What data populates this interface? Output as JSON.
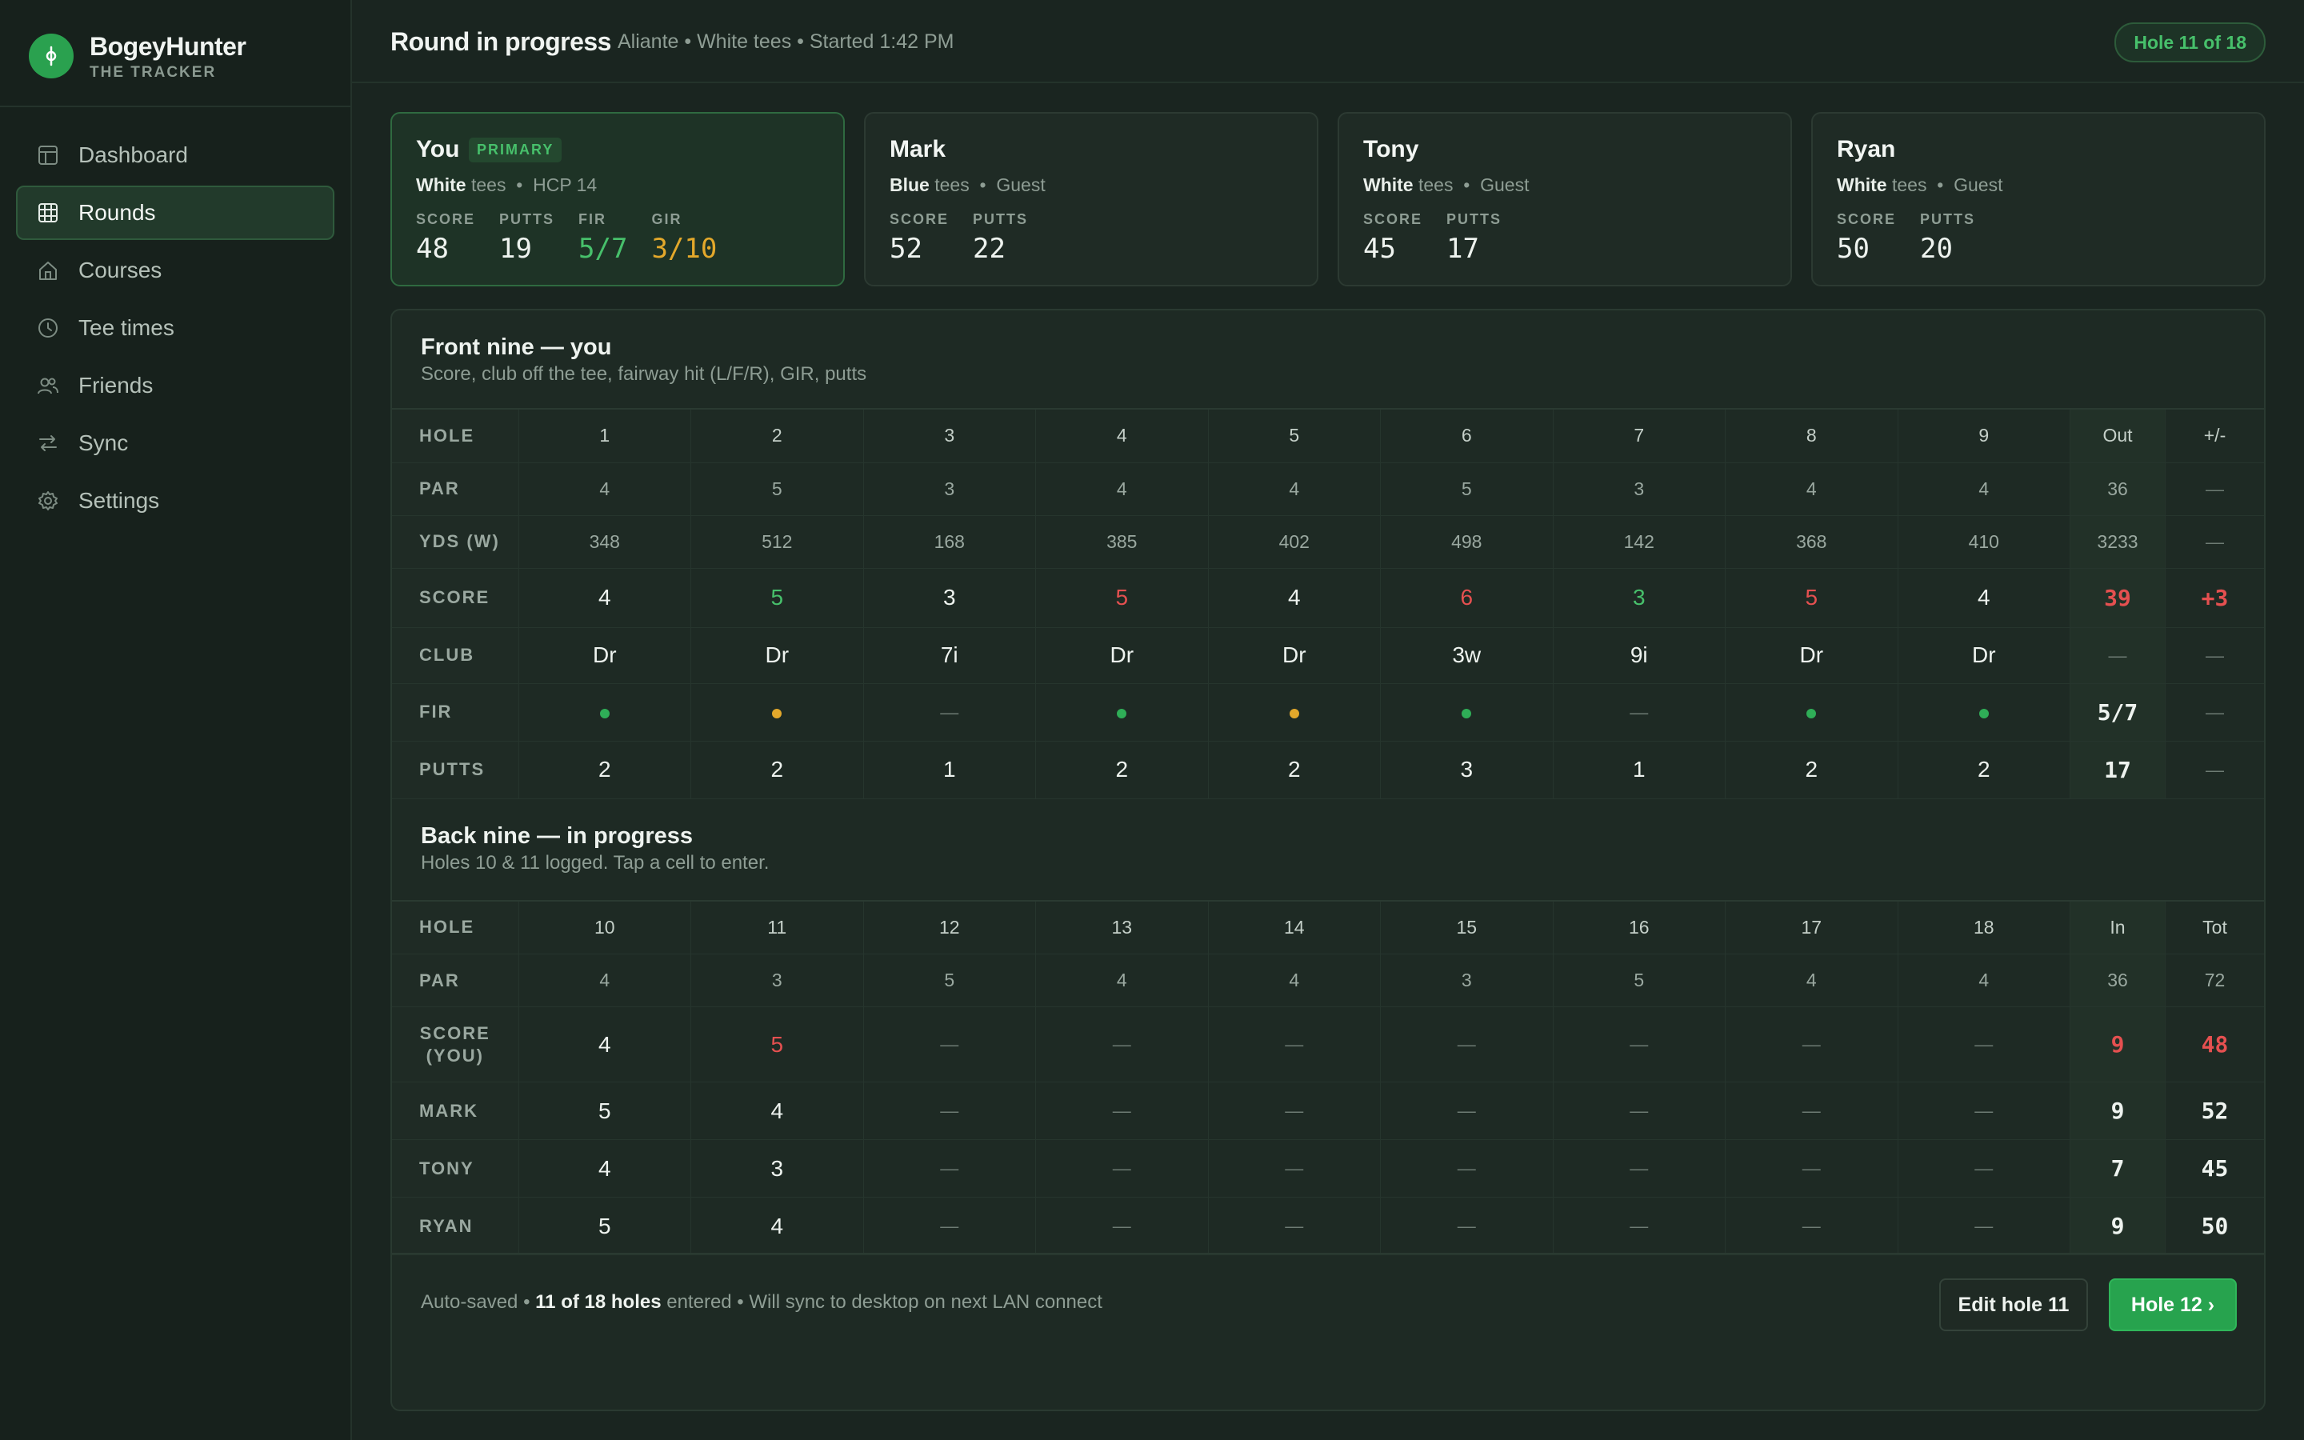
{
  "brand": {
    "name": "BogeyHunter",
    "subtitle": "THE TRACKER"
  },
  "nav": [
    {
      "label": "Dashboard",
      "icon": "dashboard-icon",
      "active": false
    },
    {
      "label": "Rounds",
      "icon": "scorecard-icon",
      "active": true
    },
    {
      "label": "Courses",
      "icon": "home-icon",
      "active": false
    },
    {
      "label": "Tee times",
      "icon": "clock-icon",
      "active": false
    },
    {
      "label": "Friends",
      "icon": "users-icon",
      "active": false
    },
    {
      "label": "Sync",
      "icon": "sync-icon",
      "active": false
    },
    {
      "label": "Settings",
      "icon": "gear-icon",
      "active": false
    }
  ],
  "header": {
    "title": "Round in progress",
    "meta": "Aliante • White tees • Started 1:42 PM",
    "badge": "Hole 11 of 18"
  },
  "players": [
    {
      "name": "You",
      "badge": "PRIMARY",
      "tee": "White",
      "tee_suffix": "tees",
      "info": "HCP 14",
      "stats": [
        {
          "label": "SCORE",
          "value": "48",
          "tone": ""
        },
        {
          "label": "PUTTS",
          "value": "19",
          "tone": ""
        },
        {
          "label": "FIR",
          "value": "5/7",
          "tone": "green"
        },
        {
          "label": "GIR",
          "value": "3/10",
          "tone": "amber"
        }
      ]
    },
    {
      "name": "Mark",
      "badge": "",
      "tee": "Blue",
      "tee_suffix": "tees",
      "info": "Guest",
      "stats": [
        {
          "label": "SCORE",
          "value": "52",
          "tone": ""
        },
        {
          "label": "PUTTS",
          "value": "22",
          "tone": ""
        }
      ]
    },
    {
      "name": "Tony",
      "badge": "",
      "tee": "White",
      "tee_suffix": "tees",
      "info": "Guest",
      "stats": [
        {
          "label": "SCORE",
          "value": "45",
          "tone": ""
        },
        {
          "label": "PUTTS",
          "value": "17",
          "tone": ""
        }
      ]
    },
    {
      "name": "Ryan",
      "badge": "",
      "tee": "White",
      "tee_suffix": "tees",
      "info": "Guest",
      "stats": [
        {
          "label": "SCORE",
          "value": "50",
          "tone": ""
        },
        {
          "label": "PUTTS",
          "value": "20",
          "tone": ""
        }
      ]
    }
  ],
  "front": {
    "title": "Front nine — you",
    "subtitle": "Score, club off the tee, fairway hit (L/F/R), GIR, putts",
    "hole_label": "HOLE",
    "holes": [
      "1",
      "2",
      "3",
      "4",
      "5",
      "6",
      "7",
      "8",
      "9"
    ],
    "out_label": "Out",
    "diff_label": "+/-",
    "rows": [
      {
        "label": "PAR",
        "kind": "small",
        "cells": [
          "4",
          "5",
          "3",
          "4",
          "4",
          "5",
          "3",
          "4",
          "4"
        ],
        "tot": "36",
        "diff": "—"
      },
      {
        "label": "YDS (W)",
        "kind": "small",
        "cells": [
          "348",
          "512",
          "168",
          "385",
          "402",
          "498",
          "142",
          "368",
          "410"
        ],
        "tot": "3233",
        "diff": "—"
      },
      {
        "label": "SCORE",
        "kind": "score",
        "cells": [
          "4",
          "5",
          "3",
          "5",
          "4",
          "6",
          "3",
          "5",
          "4"
        ],
        "tones": [
          "",
          "green",
          "",
          "red",
          "",
          "red",
          "green",
          "red",
          ""
        ],
        "tot": "39",
        "tot_tone": "red",
        "diff": "+3",
        "diff_tone": "red"
      },
      {
        "label": "CLUB",
        "kind": "big",
        "cells": [
          "Dr",
          "Dr",
          "7i",
          "Dr",
          "Dr",
          "3w",
          "9i",
          "Dr",
          "Dr"
        ],
        "tot": "—",
        "diff": "—"
      },
      {
        "label": "FIR",
        "kind": "fir",
        "cells": [
          "hit",
          "miss",
          "—",
          "hit",
          "miss",
          "hit",
          "—",
          "hit",
          "hit"
        ],
        "tot": "5/7",
        "diff": "—"
      },
      {
        "label": "PUTTS",
        "kind": "big",
        "cells": [
          "2",
          "2",
          "1",
          "2",
          "2",
          "3",
          "1",
          "2",
          "2"
        ],
        "tot": "17",
        "diff": "—"
      }
    ]
  },
  "back": {
    "title": "Back nine — in progress",
    "subtitle": "Holes 10 & 11 logged. Tap a cell to enter.",
    "hole_label": "HOLE",
    "holes": [
      "10",
      "11",
      "12",
      "13",
      "14",
      "15",
      "16",
      "17",
      "18"
    ],
    "in_label": "In",
    "tot_label": "Tot",
    "rows": [
      {
        "label": "PAR",
        "kind": "small",
        "cells": [
          "4",
          "3",
          "5",
          "4",
          "4",
          "3",
          "5",
          "4",
          "4"
        ],
        "tot": "36",
        "diff": "72"
      },
      {
        "label": "SCORE (YOU)",
        "kind": "score",
        "twoline": true,
        "cells": [
          "4",
          "5",
          "—",
          "—",
          "—",
          "—",
          "—",
          "—",
          "—"
        ],
        "tones": [
          "",
          "red",
          "",
          "",
          "",
          "",
          "",
          "",
          ""
        ],
        "tot": "9",
        "tot_tone": "red",
        "diff": "48",
        "diff_tone": "red"
      },
      {
        "label": "MARK",
        "kind": "score",
        "cells": [
          "5",
          "4",
          "—",
          "—",
          "—",
          "—",
          "—",
          "—",
          "—"
        ],
        "tones": [
          "",
          "",
          "",
          "",
          "",
          "",
          "",
          "",
          ""
        ],
        "tot": "9",
        "diff": "52"
      },
      {
        "label": "TONY",
        "kind": "score",
        "cells": [
          "4",
          "3",
          "—",
          "—",
          "—",
          "—",
          "—",
          "—",
          "—"
        ],
        "tones": [
          "",
          "",
          "",
          "",
          "",
          "",
          "",
          "",
          ""
        ],
        "tot": "7",
        "diff": "45"
      },
      {
        "label": "RYAN",
        "kind": "score",
        "cells": [
          "5",
          "4",
          "—",
          "—",
          "—",
          "—",
          "—",
          "—",
          "—"
        ],
        "tones": [
          "",
          "",
          "",
          "",
          "",
          "",
          "",
          "",
          ""
        ],
        "tot": "9",
        "diff": "50"
      }
    ]
  },
  "footer": {
    "prefix": "Auto-saved •",
    "strong": "11 of 18 holes",
    "suffix": "entered • Will sync to desktop on next LAN connect",
    "edit_label": "Edit hole 11",
    "next_label": "Hole 12 ›"
  },
  "colors": {
    "accent": "#27a34e",
    "over_par": "#e55050",
    "under_par": "#47c06b",
    "miss": "#e3a82b"
  }
}
